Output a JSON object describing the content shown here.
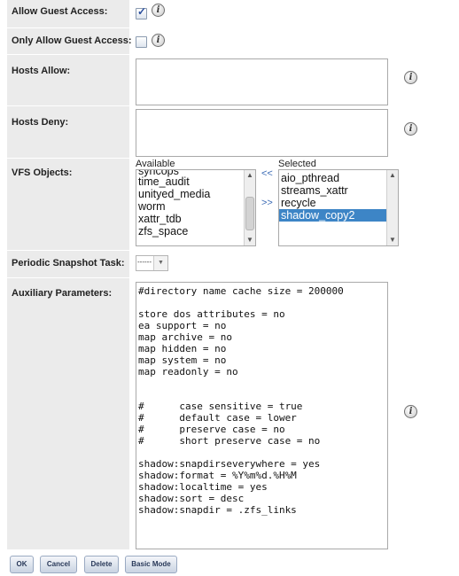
{
  "form": {
    "allow_guest_access": {
      "label": "Allow Guest Access:",
      "checked": true,
      "info_icon": "info-icon"
    },
    "only_allow_guest_access": {
      "label": "Only Allow Guest Access:",
      "checked": false,
      "info_icon": "info-icon"
    },
    "hosts_allow": {
      "label": "Hosts Allow:",
      "value": "",
      "info_icon": "info-icon"
    },
    "hosts_deny": {
      "label": "Hosts Deny:",
      "value": "",
      "info_icon": "info-icon"
    },
    "vfs_objects": {
      "label": "VFS Objects:",
      "available_label": "Available",
      "selected_label": "Selected",
      "add_label": ">>",
      "remove_label": "<<",
      "available": [
        "syncops",
        "time_audit",
        "unityed_media",
        "worm",
        "xattr_tdb",
        "zfs_space"
      ],
      "selected": [
        "aio_pthread",
        "streams_xattr",
        "recycle",
        "shadow_copy2"
      ],
      "selected_highlight": "shadow_copy2"
    },
    "periodic_snapshot_task": {
      "label": "Periodic Snapshot Task:",
      "value": "------"
    },
    "auxiliary_parameters": {
      "label": "Auxiliary Parameters:",
      "value": "#directory name cache size = 200000\n\nstore dos attributes = no\nea support = no\nmap archive = no\nmap hidden = no\nmap system = no\nmap readonly = no\n\n\n#      case sensitive = true\n#      default case = lower\n#      preserve case = no\n#      short preserve case = no\n\nshadow:snapdirseverywhere = yes\nshadow:format = %Y%m%d.%H%M\nshadow:localtime = yes\nshadow:sort = desc\nshadow:snapdir = .zfs_links",
      "info_icon": "info-icon"
    }
  },
  "buttons": {
    "ok": "OK",
    "cancel": "Cancel",
    "delete": "Delete",
    "basic_mode": "Basic Mode"
  },
  "colors": {
    "label_bg": "#ebebeb",
    "accent": "#3d85c6",
    "link": "#3b6bb5"
  }
}
